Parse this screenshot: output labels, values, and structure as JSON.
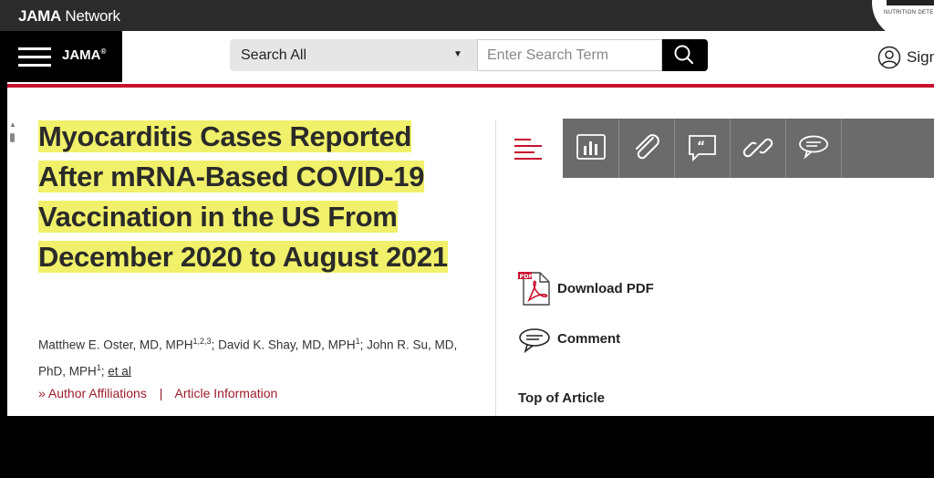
{
  "header": {
    "network_brand": "JAMA",
    "network_suffix": " Network",
    "badge_text": "NUTRITION DETE"
  },
  "nav": {
    "brand": "JAMA",
    "brand_mark": "®",
    "search_scope": "Search All",
    "search_placeholder": "Enter Search Term",
    "signin_label": "Sign"
  },
  "article": {
    "title": "Myocarditis Cases Reported After mRNA-Based COVID-19 Vaccination in the US From December 2020 to August 2021",
    "authors": [
      {
        "name": "Matthew E. Oster, MD, MPH",
        "sup": "1,2,3"
      },
      {
        "name": "David K. Shay, MD, MPH",
        "sup": "1"
      },
      {
        "name": "John R. Su, MD, PhD, MPH",
        "sup": "1"
      }
    ],
    "sep": "; ",
    "etal": "et al",
    "affiliations_link": "Author Affiliations",
    "info_link": "Article Information",
    "affil_chevron": "»",
    "affil_separator": "|"
  },
  "sidebar": {
    "download_pdf": "Download PDF",
    "comment": "Comment",
    "top_of_article": "Top of Article",
    "toolbar_icons": [
      "figures-icon",
      "attachment-icon",
      "cite-icon",
      "link-icon",
      "comment-icon"
    ]
  },
  "colors": {
    "accent_red": "#c8102e",
    "highlight_yellow": "#f0f06a",
    "toolbar_gray": "#6b6b6b"
  }
}
